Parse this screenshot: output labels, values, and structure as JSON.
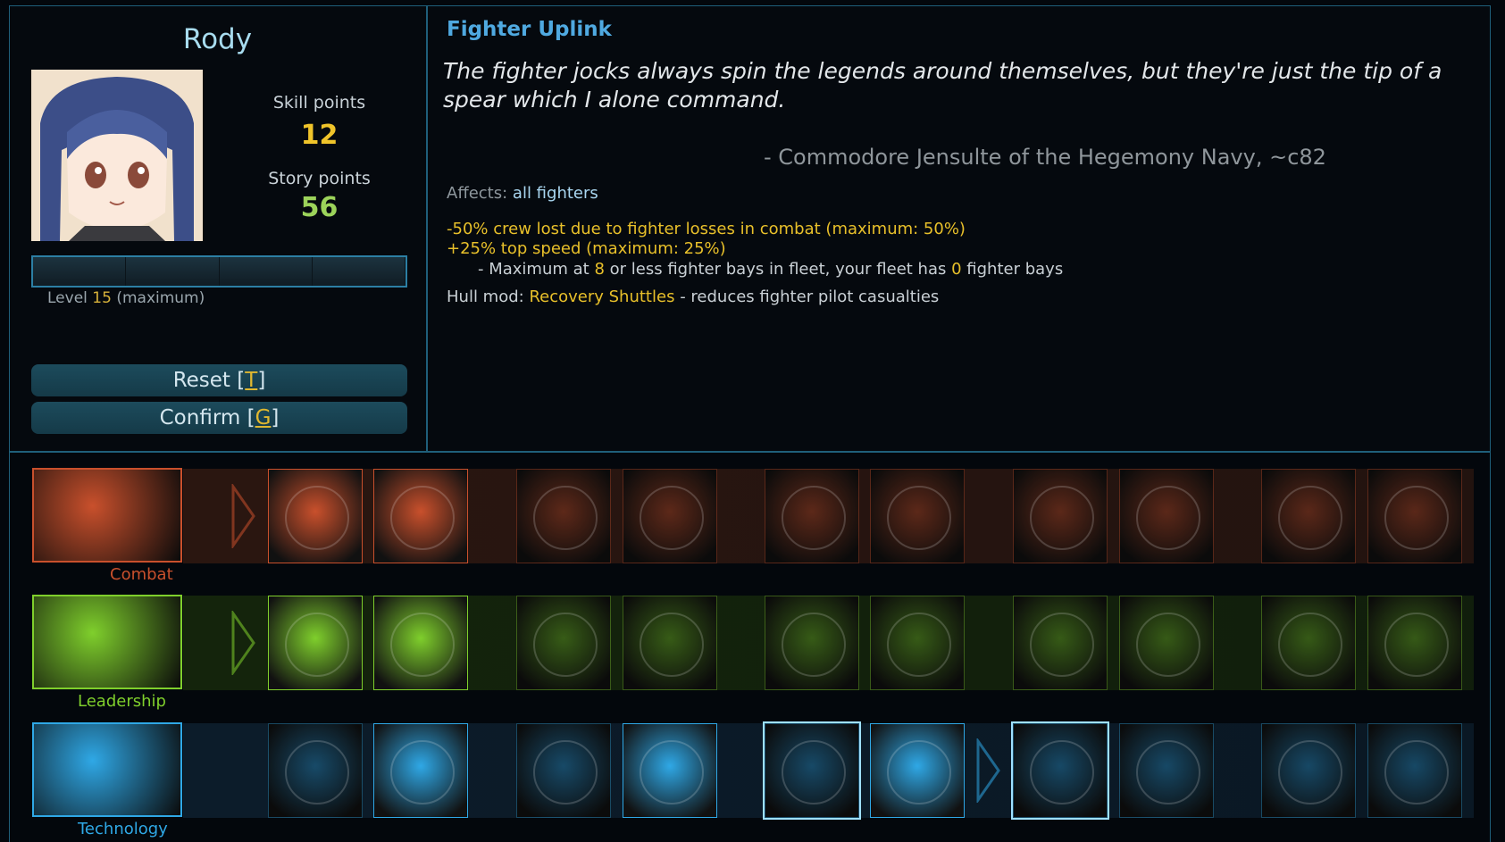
{
  "character": {
    "name": "Rody",
    "skill_points_label": "Skill points",
    "skill_points": "12",
    "story_points_label": "Story points",
    "story_points": "56",
    "level_label": "Level",
    "level_value": "15",
    "level_note": "(maximum)",
    "xp_progress": 0
  },
  "buttons": {
    "reset_label": "Reset [",
    "reset_key": "T",
    "reset_end": "]",
    "confirm_label": "Confirm [",
    "confirm_key": "G",
    "confirm_end": "]"
  },
  "skill": {
    "title": "Fighter Uplink",
    "quote": "The fighter jocks always spin the legends around themselves, but they're just the tip of a spear which I alone command.",
    "attribution": "- Commodore Jensulte of the Hegemony Navy, ~c82",
    "affects_label": "Affects:",
    "affects_value": "all fighters",
    "effect1": "-50% crew lost due to fighter losses in combat (maximum: 50%)",
    "effect2": "+25% top speed (maximum: 25%)",
    "sub_prefix": "- Maximum at",
    "sub_max": "8",
    "sub_mid": "or less fighter bays in fleet, your fleet has",
    "sub_has": "0",
    "sub_suffix": "fighter bays",
    "hull_label": "Hull mod:",
    "hull_mod": "Recovery Shuttles",
    "hull_desc": "- reduces fighter pilot casualties"
  },
  "categories": [
    {
      "label": "Combat",
      "color": "#c9502c",
      "band": "#2a1610"
    },
    {
      "label": "Leadership",
      "color": "#7fcf2c",
      "band": "#14240c"
    },
    {
      "label": "Technology",
      "color": "#2fa8e6",
      "band": "#0c1c2a"
    }
  ]
}
